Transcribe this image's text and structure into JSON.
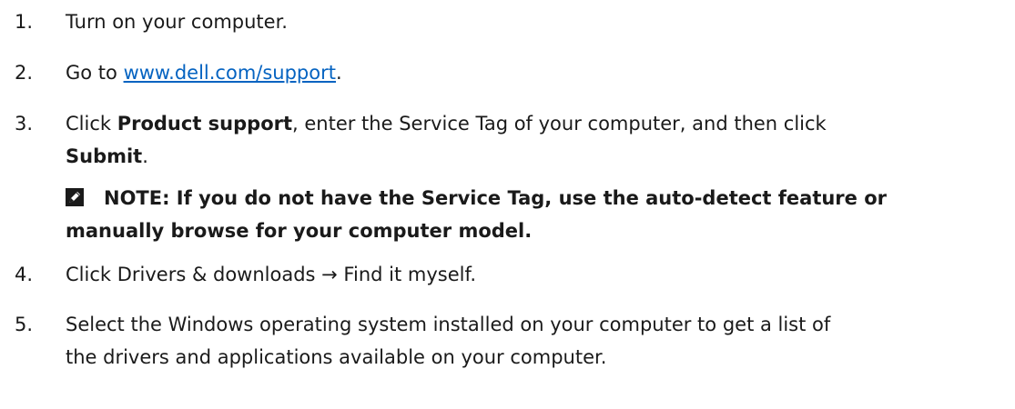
{
  "steps": [
    {
      "num": "1.",
      "text": "Turn on your computer."
    },
    {
      "num": "2.",
      "prefix": "Go to ",
      "link": "www.dell.com/support",
      "suffix": "."
    },
    {
      "num": "3.",
      "t1": "Click ",
      "b1": "Product support",
      "t2": ", enter the Service Tag of your computer, and then click",
      "b2": "Submit",
      "t3": "."
    },
    {
      "num": "4.",
      "text": "Click Drivers & downloads → Find it myself."
    },
    {
      "num": "5.",
      "line1": "Select the Windows operating system installed on your computer to get a list of",
      "line2": "the drivers and applications available on your computer."
    }
  ],
  "note": {
    "icon": "pencil-note-icon",
    "line1": "NOTE: If you do not have the Service Tag, use the auto-detect feature or",
    "line2": "manually browse for your computer model."
  }
}
